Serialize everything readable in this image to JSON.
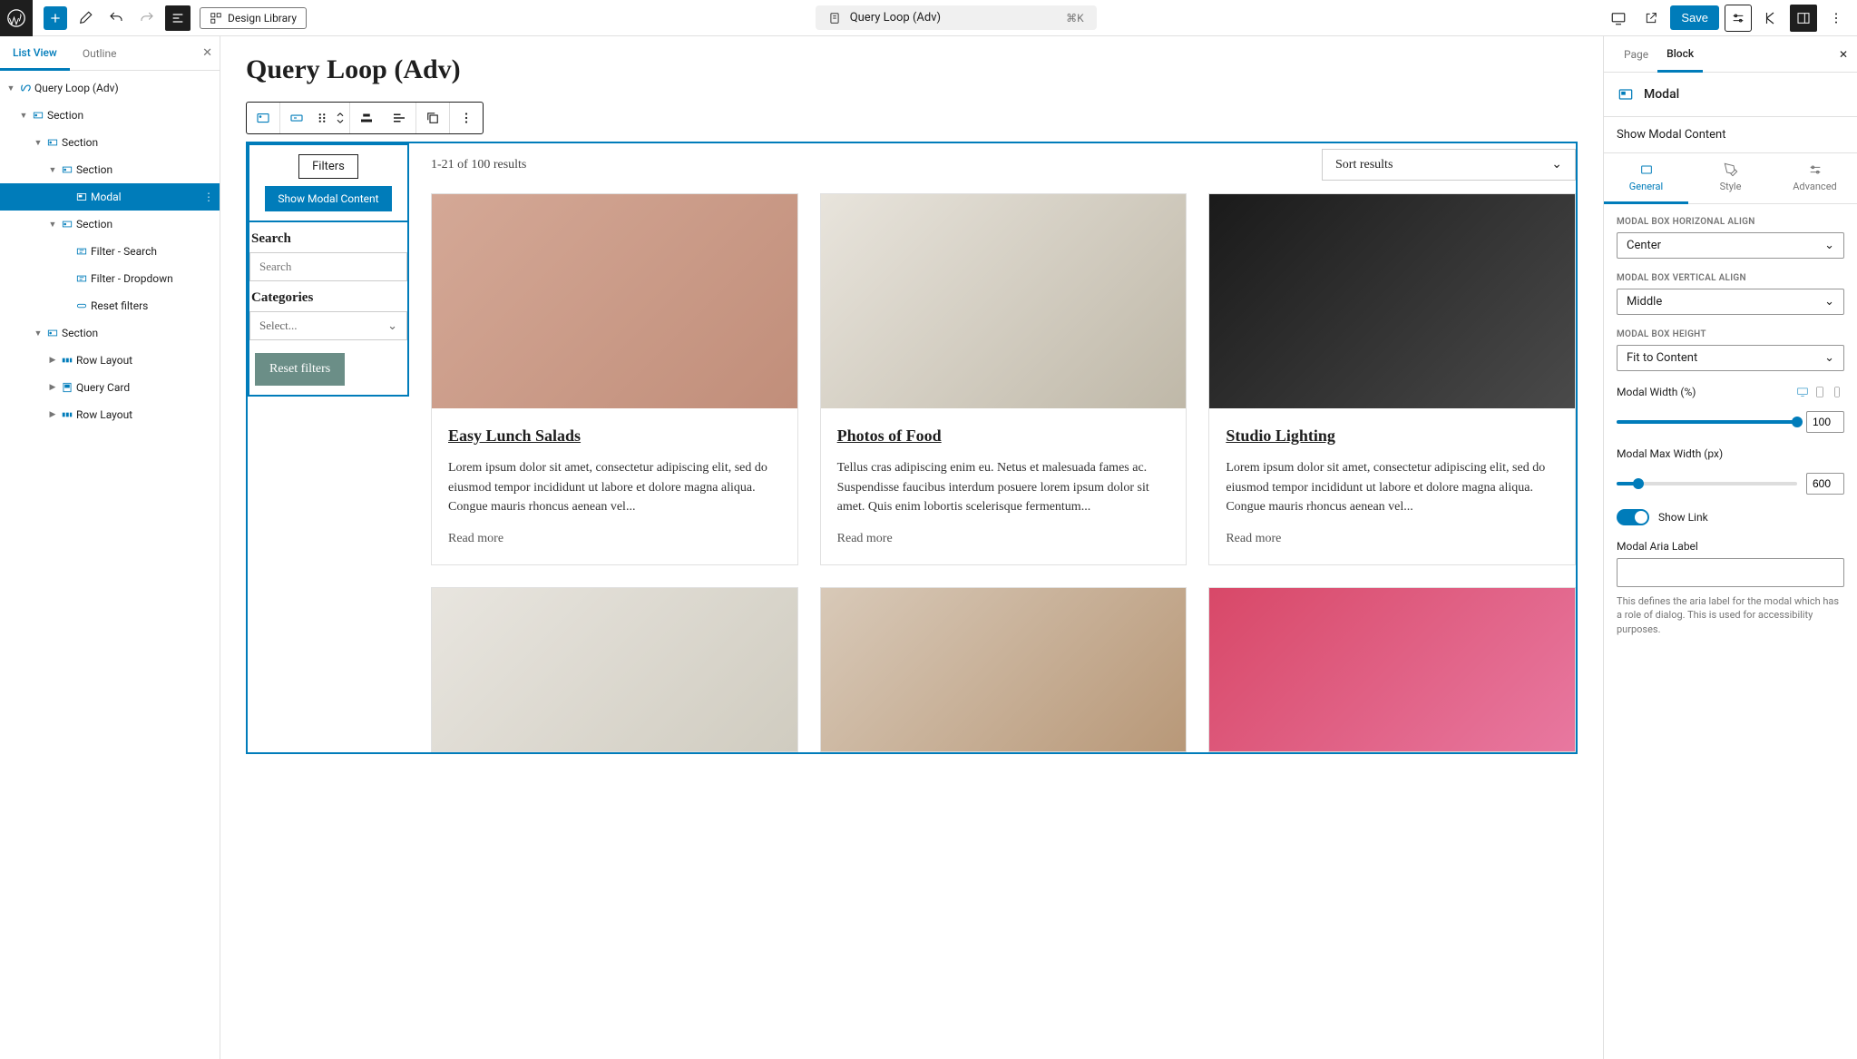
{
  "toolbar": {
    "design_library": "Design Library",
    "page_title": "Query Loop (Adv)",
    "shortcut": "⌘K",
    "save": "Save"
  },
  "left_panel": {
    "tabs": {
      "list_view": "List View",
      "outline": "Outline"
    },
    "tree": [
      {
        "label": "Query Loop (Adv)",
        "indent": 0,
        "icon": "loop",
        "caret": true
      },
      {
        "label": "Section",
        "indent": 1,
        "icon": "section",
        "caret": true
      },
      {
        "label": "Section",
        "indent": 2,
        "icon": "section",
        "caret": true
      },
      {
        "label": "Section",
        "indent": 3,
        "icon": "section",
        "caret": true
      },
      {
        "label": "Modal",
        "indent": 4,
        "icon": "modal",
        "selected": true
      },
      {
        "label": "Section",
        "indent": 3,
        "icon": "section",
        "caret": true
      },
      {
        "label": "Filter - Search",
        "indent": 4,
        "icon": "filter"
      },
      {
        "label": "Filter - Dropdown",
        "indent": 4,
        "icon": "filter"
      },
      {
        "label": "Reset filters",
        "indent": 4,
        "icon": "button"
      },
      {
        "label": "Section",
        "indent": 2,
        "icon": "section",
        "caret": true
      },
      {
        "label": "Row Layout",
        "indent": 3,
        "icon": "row",
        "caret": true,
        "closed": true
      },
      {
        "label": "Query Card",
        "indent": 3,
        "icon": "card",
        "caret": true,
        "closed": true
      },
      {
        "label": "Row Layout",
        "indent": 3,
        "icon": "row",
        "caret": true,
        "closed": true
      }
    ]
  },
  "canvas": {
    "title": "Query Loop (Adv)",
    "filters": {
      "button": "Filters",
      "show_modal": "Show Modal Content",
      "search_label": "Search",
      "search_placeholder": "Search",
      "categories_label": "Categories",
      "categories_placeholder": "Select...",
      "reset": "Reset filters"
    },
    "results_count": "1-21 of 100 results",
    "sort_label": "Sort results",
    "cards": [
      {
        "title": "Easy Lunch Salads",
        "text": "Lorem ipsum dolor sit amet, consectetur adipiscing elit, sed do eiusmod tempor incididunt ut labore et dolore magna aliqua. Congue mauris rhoncus aenean vel...",
        "link": "Read more",
        "img": "i1"
      },
      {
        "title": "Photos of Food",
        "text": "Tellus cras adipiscing enim eu. Netus et malesuada fames ac. Suspendisse faucibus interdum posuere lorem ipsum dolor sit amet. Quis enim lobortis scelerisque fermentum...",
        "link": "Read more",
        "img": "i2"
      },
      {
        "title": "Studio Lighting",
        "text": "Lorem ipsum dolor sit amet, consectetur adipiscing elit, sed do eiusmod tempor incididunt ut labore et dolore magna aliqua. Congue mauris rhoncus aenean vel...",
        "link": "Read more",
        "img": "i3"
      },
      {
        "title": "",
        "text": "",
        "link": "",
        "img": "i4"
      },
      {
        "title": "",
        "text": "",
        "link": "",
        "img": "i5"
      },
      {
        "title": "",
        "text": "",
        "link": "",
        "img": "i6"
      }
    ]
  },
  "right_panel": {
    "tabs": {
      "page": "Page",
      "block": "Block"
    },
    "block_name": "Modal",
    "show_modal": "Show Modal Content",
    "subtabs": {
      "general": "General",
      "style": "Style",
      "advanced": "Advanced"
    },
    "fields": {
      "h_align_label": "MODAL BOX HORIZONAL ALIGN",
      "h_align_value": "Center",
      "v_align_label": "MODAL BOX VERTICAL ALIGN",
      "v_align_value": "Middle",
      "height_label": "MODAL BOX HEIGHT",
      "height_value": "Fit to Content",
      "width_label": "Modal Width (%)",
      "width_value": "100",
      "max_width_label": "Modal Max Width (px)",
      "max_width_value": "600",
      "show_link": "Show Link",
      "aria_label": "Modal Aria Label",
      "aria_help": "This defines the aria label for the modal which has a role of dialog. This is used for accessibility purposes."
    }
  }
}
